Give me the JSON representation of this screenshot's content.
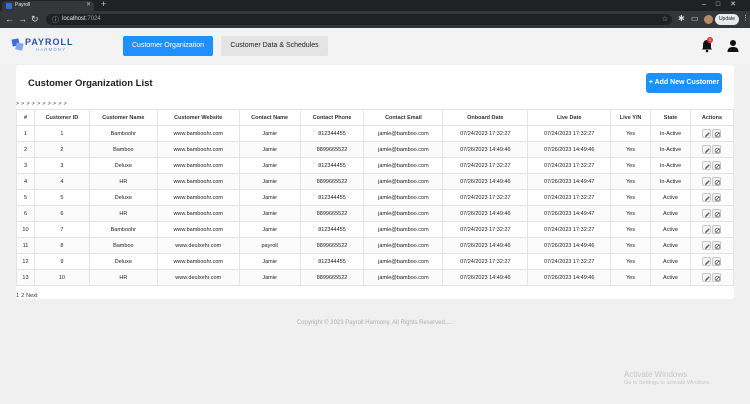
{
  "browser": {
    "tab_title": "Payroll",
    "url_host": "localhost",
    "url_port": ":7024",
    "update_label": "Update"
  },
  "app": {
    "logo_title": "PAYROLL",
    "logo_sub": "HARMONY",
    "nav": {
      "active": "Customer Organization",
      "inactive": "Customer Data & Schedules"
    },
    "notification_count": "1"
  },
  "page": {
    "title": "Customer Organization List",
    "add_button": "+ Add New Customer",
    "arrows": "> > > > > > > > > >"
  },
  "table": {
    "headers": [
      "#",
      "Customer ID",
      "Customer Name",
      "Customer Website",
      "Contact Name",
      "Contact Phone",
      "Contact Email",
      "Onboard Date",
      "Live Date",
      "Live Y/N",
      "State",
      "Actions"
    ],
    "rows": [
      [
        "1",
        "1",
        "Bamboohr",
        "www.bamboohr.com",
        "Jamie",
        "812344455",
        "jamie@bamboo.com",
        "07/24/2023 17:32:27",
        "07/24/2023 17:32:27",
        "Yes",
        "In-Active"
      ],
      [
        "2",
        "2",
        "Bamboo",
        "www.bamboohr.com",
        "Jamie",
        "8899665522",
        "jamie@bamboo.com",
        "07/26/2023 14:49:46",
        "07/26/2023 14:49:46",
        "Yes",
        "In-Active"
      ],
      [
        "3",
        "3",
        "Deluxe",
        "www.bamboohr.com",
        "Jamie",
        "812344455",
        "jamie@bamboo.com",
        "07/24/2023 17:32:27",
        "07/24/2023 17:32:27",
        "Yes",
        "In-Active"
      ],
      [
        "4",
        "4",
        "HR",
        "www.bamboohr.com",
        "Jamie",
        "8899665522",
        "jamie@bamboo.com",
        "07/26/2023 14:49:46",
        "07/26/2023 14:49:47",
        "Yes",
        "In-Active"
      ],
      [
        "5",
        "5",
        "Deluxe",
        "www.bamboohr.com",
        "Jamie",
        "812344455",
        "jamie@bamboo.com",
        "07/24/2023 17:32:27",
        "07/24/2023 17:32:27",
        "Yes",
        "Active"
      ],
      [
        "6",
        "6",
        "HR",
        "www.bamboohr.com",
        "Jamie",
        "8899665522",
        "jamie@bamboo.com",
        "07/26/2023 14:49:46",
        "07/26/2023 14:49:47",
        "Yes",
        "Active"
      ],
      [
        "10",
        "7",
        "Bamboohr",
        "www.bamboohr.com",
        "Jamie",
        "812344455",
        "jamie@bamboo.com",
        "07/24/2023 17:32:27",
        "07/24/2023 17:32:27",
        "Yes",
        "Active"
      ],
      [
        "11",
        "8",
        "Bamboo",
        "www.deulxehr.com",
        "payroll",
        "8899665522",
        "jamie@bamboo.com",
        "07/26/2023 14:49:46",
        "07/26/2023 14:49:46",
        "Yes",
        "Active"
      ],
      [
        "12",
        "9",
        "Deluxe",
        "www.bamboohr.com",
        "Jamie",
        "812344455",
        "jamie@bamboo.com",
        "07/24/2023 17:32:27",
        "07/24/2023 17:32:27",
        "Yes",
        "Active"
      ],
      [
        "13",
        "10",
        "HR",
        "www.deulxehr.com",
        "Jamie",
        "8899665522",
        "jamie@bamboo.com",
        "07/26/2023 14:49:46",
        "07/26/2023 14:49:46",
        "Yes",
        "Active"
      ]
    ]
  },
  "pager": {
    "p1": "1",
    "p2": "2",
    "next": "Next"
  },
  "footer": "Copyright © 2023 Payroll Harmony. All Rights Reserved.....",
  "windows": {
    "line1": "Activate Windows",
    "line2": "Go to Settings to activate Windows."
  }
}
